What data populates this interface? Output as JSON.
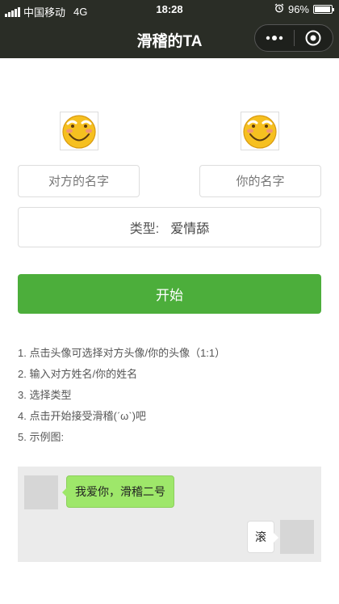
{
  "status_bar": {
    "carrier": "中国移动",
    "network": "4G",
    "time": "18:28",
    "battery": "96%",
    "battery_level": 0.96
  },
  "nav": {
    "title": "滑稽的TA"
  },
  "colors": {
    "nav_bg": "#2a2d26",
    "primary_green": "#4cae3b",
    "bubble_green": "#9ee76a"
  },
  "form": {
    "other_name_placeholder": "对方的名字",
    "my_name_placeholder": "你的名字",
    "type_label": "类型:",
    "type_value": "爱情舔",
    "start_button": "开始"
  },
  "instructions": [
    "1. 点击头像可选择对方头像/你的头像（1:1）",
    "2. 输入对方姓名/你的姓名",
    "3. 选择类型",
    "4. 点击开始接受滑稽(ˊωˋ)吧",
    "5. 示例图:"
  ],
  "example": {
    "message_left": "我爱你，滑稽二号",
    "message_right": "滚"
  }
}
